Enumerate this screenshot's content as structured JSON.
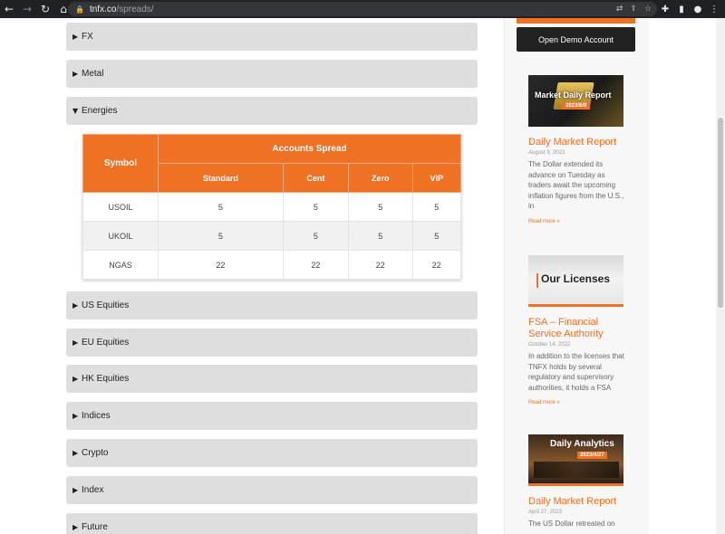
{
  "browser": {
    "url_host": "tnfx.co",
    "url_path": "/spreads/"
  },
  "accordions": [
    {
      "label": "FX",
      "expanded": false
    },
    {
      "label": "Metal",
      "expanded": false
    },
    {
      "label": "Energies",
      "expanded": true
    },
    {
      "label": "US Equities",
      "expanded": false
    },
    {
      "label": "EU Equities",
      "expanded": false
    },
    {
      "label": "HK Equities",
      "expanded": false
    },
    {
      "label": "Indices",
      "expanded": false
    },
    {
      "label": "Crypto",
      "expanded": false
    },
    {
      "label": "Index",
      "expanded": false
    },
    {
      "label": "Future",
      "expanded": false
    }
  ],
  "table": {
    "symbol_header": "Symbol",
    "group_header": "Accounts Spread",
    "columns": [
      "Standard",
      "Cent",
      "Zero",
      "VIP"
    ],
    "rows": [
      {
        "symbol": "USOIL",
        "values": [
          "5",
          "5",
          "5",
          "5"
        ]
      },
      {
        "symbol": "UKOIL",
        "values": [
          "5",
          "5",
          "5",
          "5"
        ]
      },
      {
        "symbol": "NGAS",
        "values": [
          "22",
          "22",
          "22",
          "22"
        ]
      }
    ]
  },
  "sidebar": {
    "demo_button": "Open Demo Account",
    "posts": [
      {
        "thumb_title": "Market Daily Report",
        "thumb_subtitle": "2023/8/9",
        "title": "Daily Market Report",
        "date": "August 9, 2023",
        "excerpt": "The Dollar extended its advance on Tuesday as traders await the upcoming inflation figures from the U.S., in",
        "read_more": "Read more »"
      },
      {
        "thumb_title": "Our Licenses",
        "title": "FSA – Financial Service Authority",
        "date": "October 14, 2022",
        "excerpt": "In addition to the licenses that TNFX holds by several regulatory and supervisory authorities, it holds a FSA",
        "read_more": "Read more »"
      },
      {
        "thumb_title": "Daily Analytics",
        "thumb_subtitle": "2023/4/27",
        "title": "Daily Market Report",
        "date": "April 27, 2023",
        "excerpt": "The US Dollar retreated on"
      }
    ]
  },
  "colors": {
    "accent": "#ee7124",
    "dark": "#222222"
  }
}
